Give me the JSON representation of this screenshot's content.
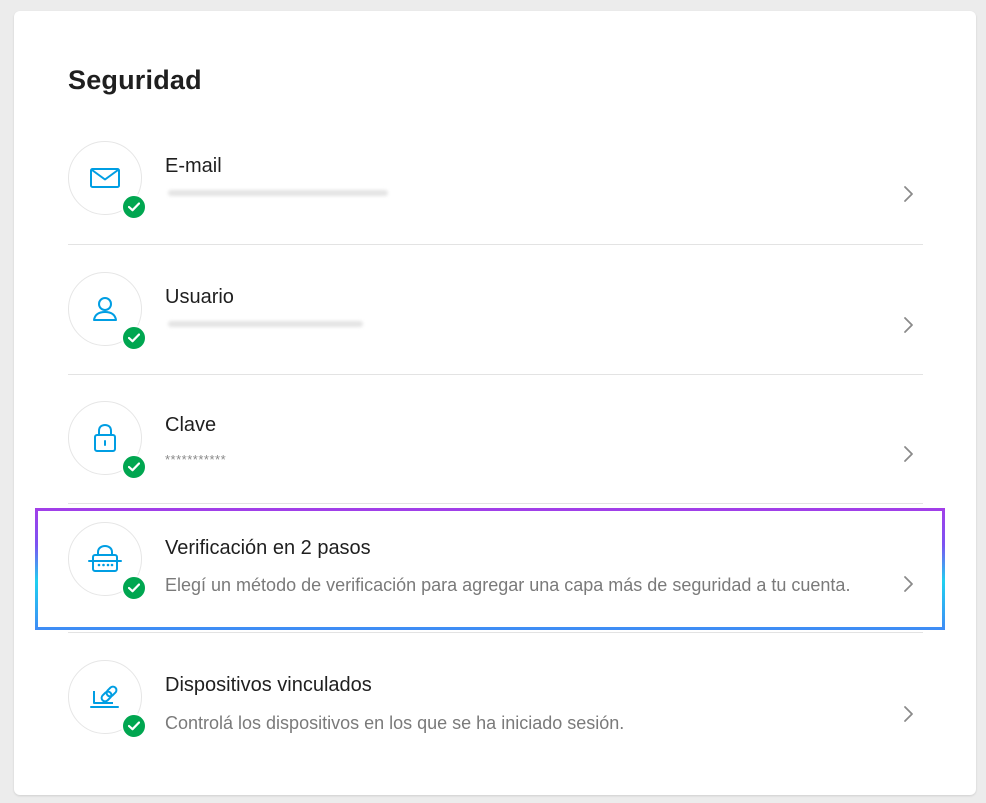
{
  "page": {
    "title": "Seguridad"
  },
  "colors": {
    "accent": "#009ee3",
    "check": "#00a650",
    "highlight_gradient": [
      "#a33ee8",
      "#1fd0f0",
      "#3f8bf5"
    ]
  },
  "items": [
    {
      "title": "E-mail",
      "subtitle": "",
      "icon": "envelope-icon",
      "status": "verified",
      "value_redacted": true
    },
    {
      "title": "Usuario",
      "subtitle": "",
      "icon": "user-icon",
      "status": "verified",
      "value_redacted": true
    },
    {
      "title": "Clave",
      "subtitle": "***********",
      "icon": "lock-icon",
      "status": "verified"
    },
    {
      "title": "Verificación en 2 pasos",
      "subtitle": "Elegí un método de verificación para agregar una capa más de seguridad a tu cuenta.",
      "icon": "keypad-lock-icon",
      "status": "verified",
      "highlighted": true
    },
    {
      "title": "Dispositivos vinculados",
      "subtitle": "Controlá los dispositivos en los que se ha iniciado sesión.",
      "icon": "linked-device-icon",
      "status": "verified"
    }
  ]
}
